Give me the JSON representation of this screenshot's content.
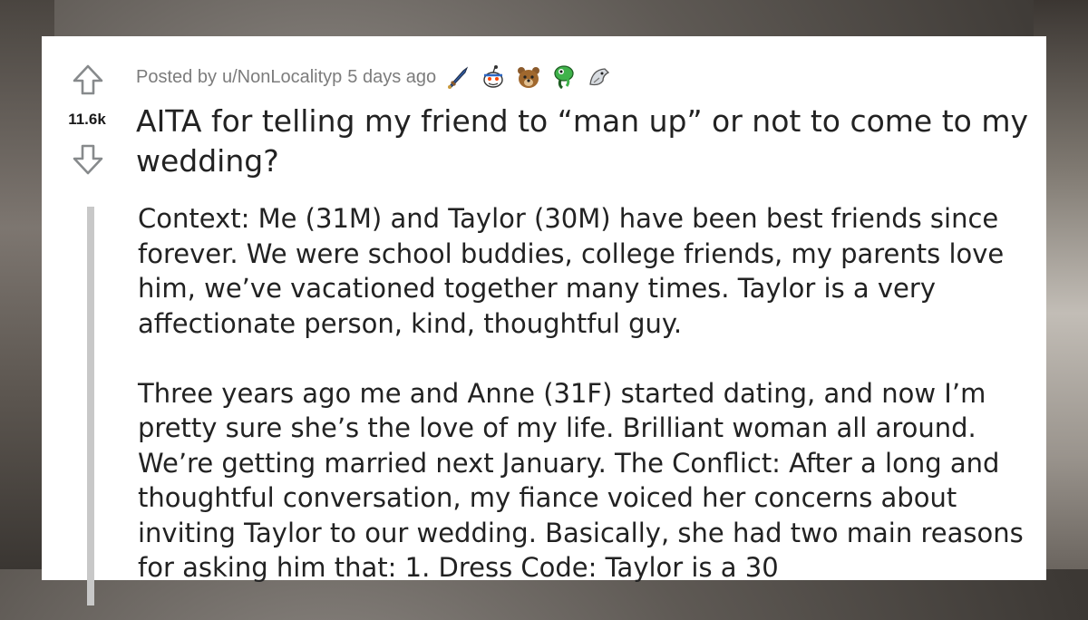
{
  "post": {
    "posted_by_prefix": "Posted by",
    "author": "u/NonLocalityp",
    "time_ago": "5 days ago",
    "vote_count": "11.6k",
    "awards": [
      "sword-award-icon",
      "reddit-snoo-award-icon",
      "bear-award-icon",
      "green-creature-award-icon",
      "silver-creature-award-icon"
    ],
    "title": "AITA for telling my friend to “man up” or not to come to my wedding?",
    "body": [
      "Context: Me (31M) and Taylor (30M) have been best friends since forever. We were school buddies, college friends, my parents love him, we’ve vacationed together many times. Taylor is a very affectionate person, kind, thoughtful guy.",
      "Three years ago me and Anne (31F) started dating, and now I’m pretty sure she’s the love of my life. Brilliant woman all around. We’re getting married next January. The Conflict: After a long and thoughtful conversation, my fiance voiced her concerns about inviting Taylor to our wedding. Basically, she had two main reasons for asking him that: 1. Dress Code: Taylor is a 30"
    ]
  },
  "colors": {
    "card_bg": "#ffffff",
    "text": "#222222",
    "meta": "#7c7c7c",
    "vote_icon": "#878a8c",
    "quote_bar": "#c8c8c8"
  }
}
